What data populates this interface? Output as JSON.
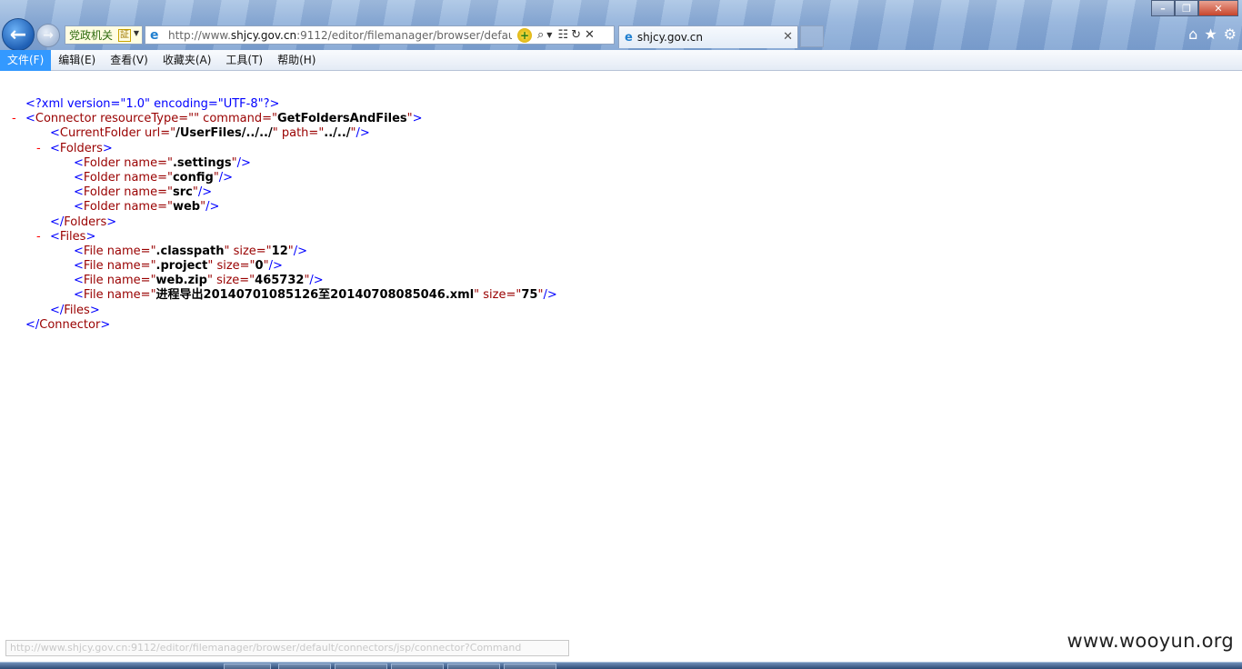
{
  "browser": {
    "zone_label": "党政机关",
    "zone_badge": "証",
    "url_prefix": "http://www.",
    "url_domain": "shjcy.gov.cn",
    "url_rest": ":9112/editor/filemanager/browser/default",
    "tab_title": "shjcy.gov.cn",
    "icons": {
      "back": "back-arrow-icon",
      "forward": "forward-arrow-icon",
      "compat": "compatibility-view-icon",
      "search": "search-icon",
      "refresh": "refresh-icon",
      "stop": "stop-icon",
      "home": "home-icon",
      "favorites": "star-icon",
      "tools": "gear-icon"
    }
  },
  "menu": [
    "文件(F)",
    "编辑(E)",
    "查看(V)",
    "收藏夹(A)",
    "工具(T)",
    "帮助(H)"
  ],
  "xml": {
    "declaration": "<?xml version=\"1.0\" encoding=\"UTF-8\"?>",
    "connector": {
      "tag": "Connector",
      "resourceType": "",
      "command": "GetFoldersAndFiles"
    },
    "current_folder": {
      "tag": "CurrentFolder",
      "url": "/UserFiles/../../",
      "path": "../../"
    },
    "folders_tag": "Folders",
    "folders": [
      ".settings",
      "config",
      "src",
      "web"
    ],
    "files_tag": "Files",
    "files": [
      {
        "name": ".classpath",
        "size": "12"
      },
      {
        "name": ".project",
        "size": "0"
      },
      {
        "name": "web.zip",
        "size": "465732"
      },
      {
        "name": "进程导出20140701085126至20140708085046.xml",
        "size": "75"
      }
    ],
    "collapse_marker": "-"
  },
  "status_url": "http://www.shjcy.gov.cn:9112/editor/filemanager/browser/default/connectors/jsp/connector?Command",
  "watermark": "www.wooyun.org"
}
